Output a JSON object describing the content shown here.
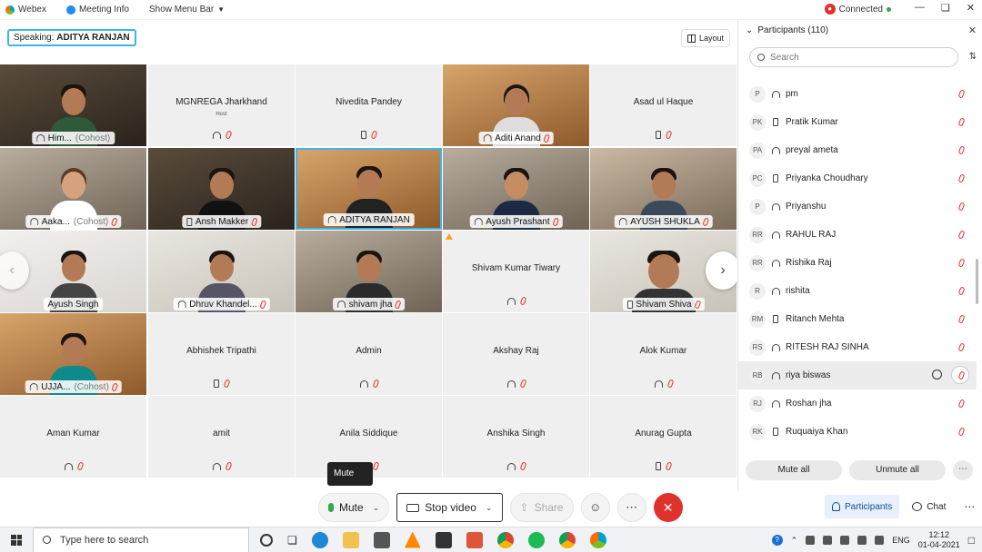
{
  "titlebar": {
    "app_name": "Webex",
    "meeting_info": "Meeting Info",
    "show_menu_bar": "Show Menu Bar",
    "status": "Connected"
  },
  "speaking": {
    "prefix": "Speaking:",
    "name": "ADITYA RANJAN"
  },
  "layout_button": "Layout",
  "tiles": [
    {
      "name": "Him...",
      "cohost": "(Cohost)",
      "type": "video",
      "label_icon": "headset"
    },
    {
      "name": "MGNREGA Jharkhand",
      "sub": "Host",
      "type": "audio",
      "icon": "headset-group"
    },
    {
      "name": "Nivedita Pandey",
      "type": "audio",
      "icon": "phone"
    },
    {
      "name": "Aditi Anand",
      "type": "video",
      "label_icon": "headset"
    },
    {
      "name": "Asad ul Haque",
      "type": "audio",
      "icon": "phone"
    },
    {
      "name": "Aaka...",
      "cohost": "(Cohost)",
      "type": "video",
      "label_icon": "headset"
    },
    {
      "name": "Ansh Makker",
      "type": "video",
      "label_icon": "phone"
    },
    {
      "name": "ADITYA RANJAN",
      "type": "video",
      "label_icon": "headset"
    },
    {
      "name": "Ayush Prashant",
      "type": "video",
      "label_icon": "headset"
    },
    {
      "name": "AYUSH SHUKLA",
      "type": "video",
      "label_icon": "headset"
    },
    {
      "name": "Ayush Singh",
      "type": "video",
      "label_icon": "none"
    },
    {
      "name": "Dhruv Khandel...",
      "type": "video",
      "label_icon": "headset"
    },
    {
      "name": "shivam jha",
      "type": "video",
      "label_icon": "headset"
    },
    {
      "name": "Shivam Kumar Tiwary",
      "type": "audio",
      "icon": "headset"
    },
    {
      "name": "Shivam Shiva",
      "type": "video",
      "label_icon": "phone"
    },
    {
      "name": "UJJA...",
      "cohost": "(Cohost)",
      "type": "video",
      "label_icon": "none"
    },
    {
      "name": "Abhishek Tripathi",
      "type": "audio",
      "icon": "phone"
    },
    {
      "name": "Admin",
      "type": "audio",
      "icon": "headset"
    },
    {
      "name": "Akshay Raj",
      "type": "audio",
      "icon": "headset"
    },
    {
      "name": "Alok Kumar",
      "type": "audio",
      "icon": "headset"
    },
    {
      "name": "Aman Kumar",
      "type": "audio",
      "icon": "headset"
    },
    {
      "name": "amit",
      "type": "audio",
      "icon": "headset"
    },
    {
      "name": "Anila Siddique",
      "type": "audio",
      "icon": "headset"
    },
    {
      "name": "Anshika Singh",
      "type": "audio",
      "icon": "headset"
    },
    {
      "name": "Anurag Gupta",
      "type": "audio",
      "icon": "phone"
    }
  ],
  "tooltip": "Mute",
  "controls": {
    "mute": "Mute",
    "stop_video": "Stop video",
    "share": "Share"
  },
  "panel": {
    "title": "Participants (110)",
    "search_placeholder": "Search",
    "participants": [
      {
        "initials": "P",
        "name": "pm",
        "device": "headset"
      },
      {
        "initials": "PK",
        "name": "Pratik Kumar",
        "device": "phone"
      },
      {
        "initials": "PA",
        "name": "preyal ameta",
        "device": "headset"
      },
      {
        "initials": "PC",
        "name": "Priyanka Choudhary",
        "device": "phone"
      },
      {
        "initials": "P",
        "name": "Priyanshu",
        "device": "headset"
      },
      {
        "initials": "RR",
        "name": "RAHUL RAJ",
        "device": "headset"
      },
      {
        "initials": "RR",
        "name": "Rishika Raj",
        "device": "headset"
      },
      {
        "initials": "R",
        "name": "rishita",
        "device": "headset"
      },
      {
        "initials": "RM",
        "name": "Ritanch Mehta",
        "device": "phone"
      },
      {
        "initials": "RS",
        "name": "RITESH RAJ SINHA",
        "device": "headset"
      },
      {
        "initials": "RB",
        "name": "riya biswas",
        "device": "headset",
        "highlighted": true
      },
      {
        "initials": "RJ",
        "name": "Roshan jha",
        "device": "headset"
      },
      {
        "initials": "RK",
        "name": "Ruquaiya Khan",
        "device": "phone"
      }
    ],
    "mute_all": "Mute all",
    "unmute_all": "Unmute all"
  },
  "side_buttons": {
    "participants": "Participants",
    "chat": "Chat"
  },
  "taskbar": {
    "search_placeholder": "Type here to search",
    "language": "ENG",
    "time": "12:12",
    "date": "01-04-2021"
  },
  "colors": {
    "accent": "#3bb6e8",
    "danger": "#e0322c",
    "mic_on": "#2fa84f"
  }
}
